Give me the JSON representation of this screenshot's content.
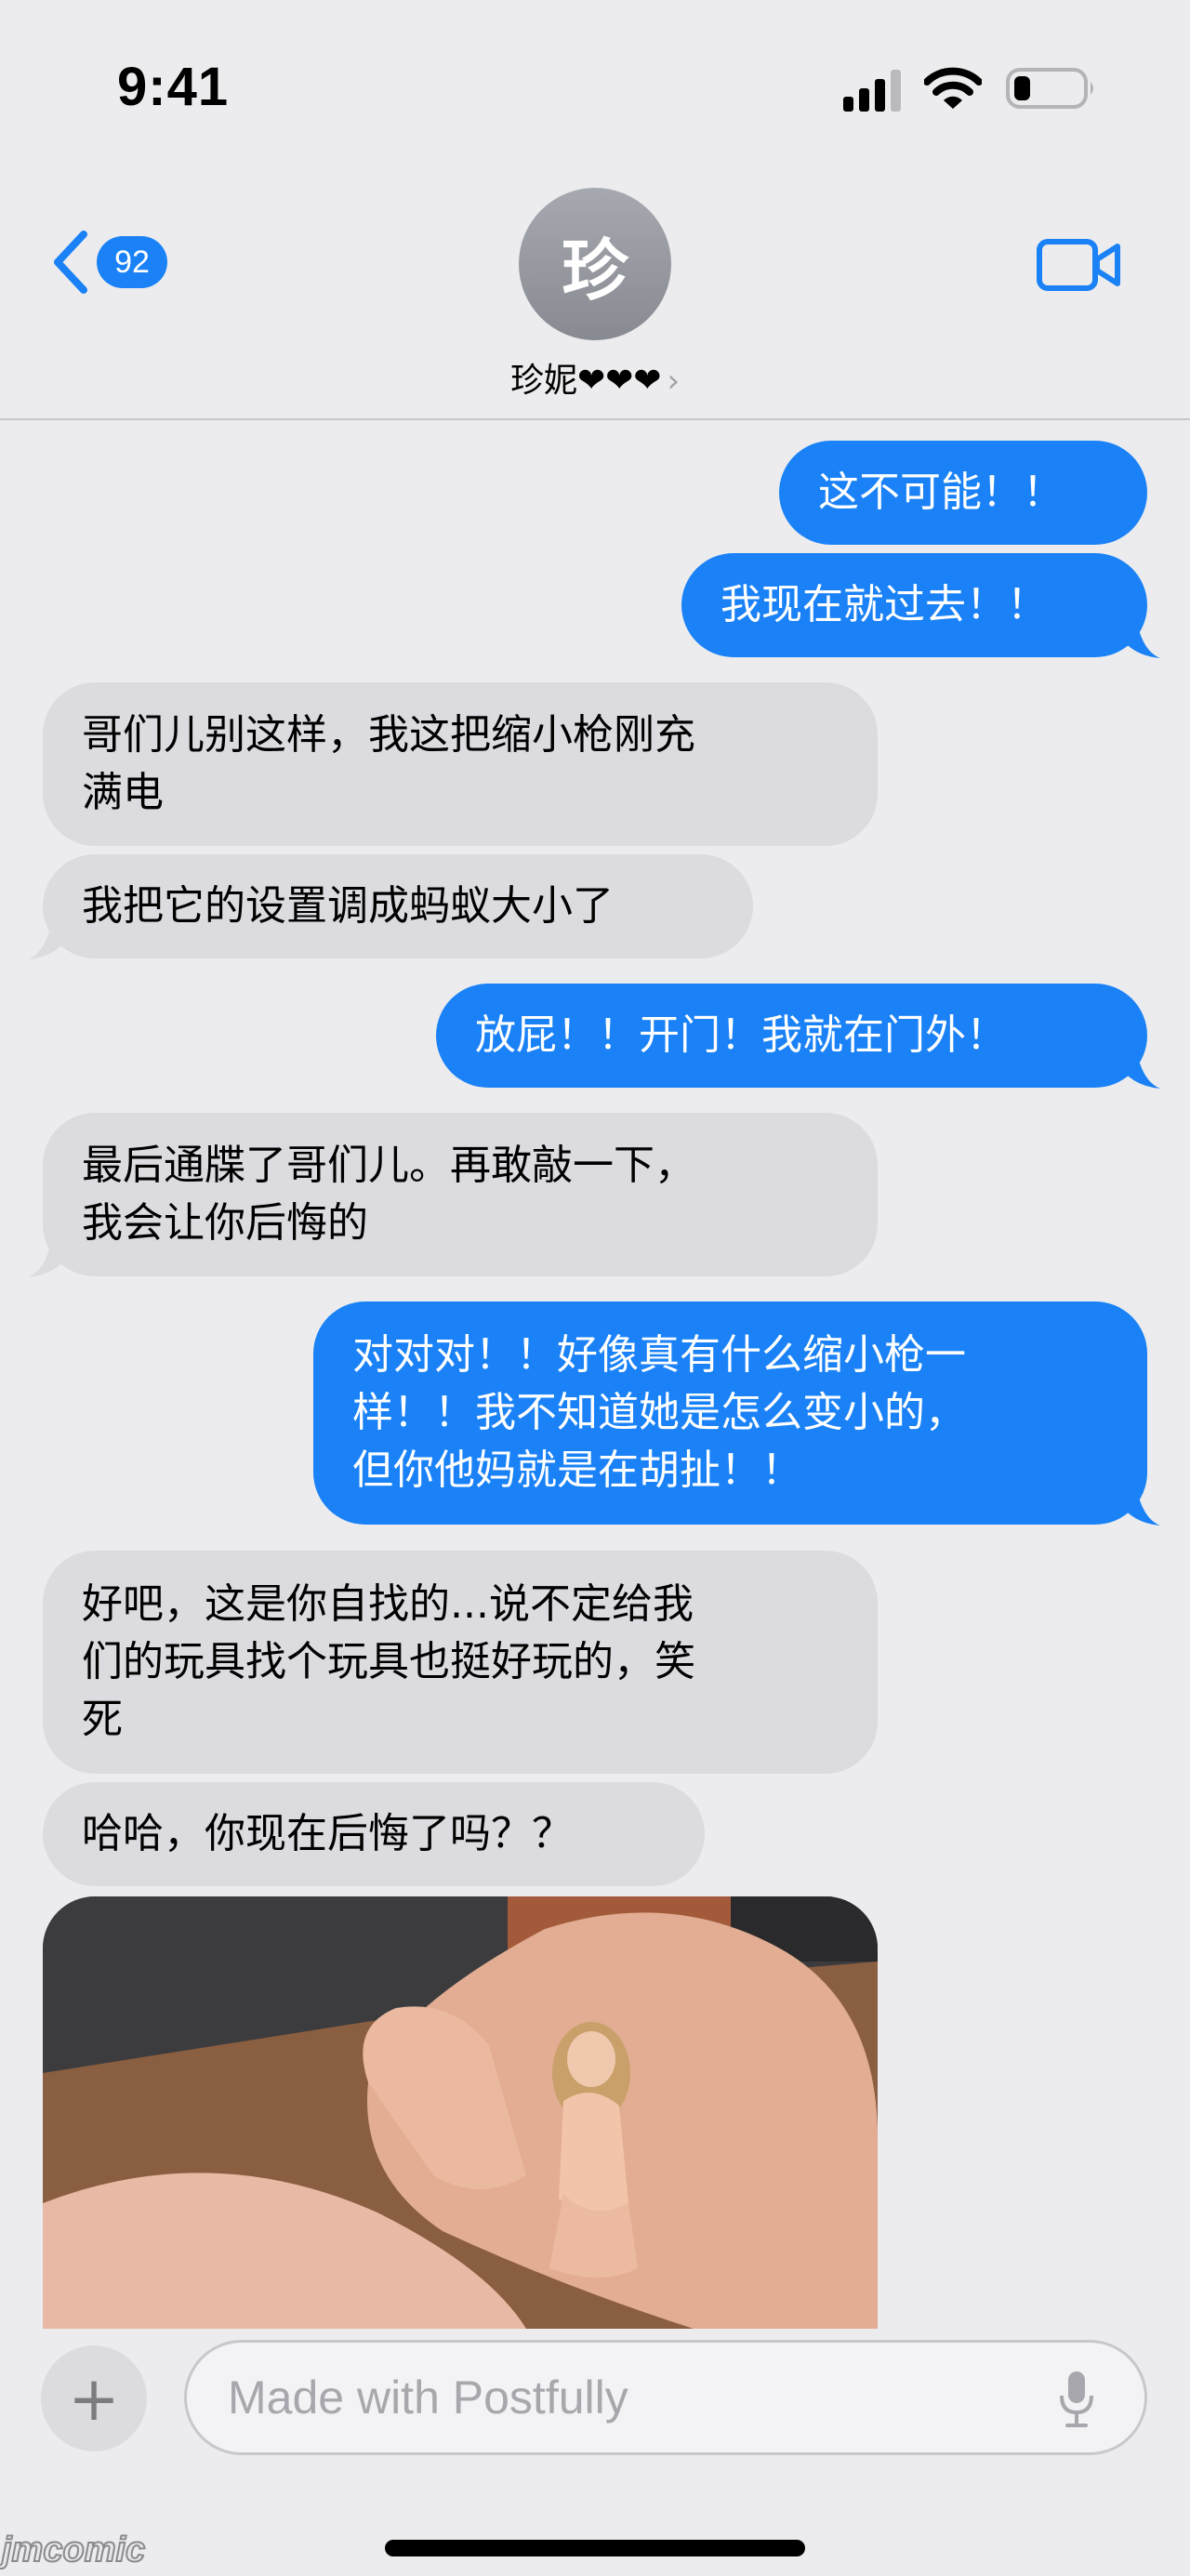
{
  "status_bar": {
    "time": "9:41"
  },
  "header": {
    "unread_count": "92",
    "avatar_initial": "珍",
    "contact_name": "珍妮❤❤❤",
    "contact_chevron": "›"
  },
  "messages": [
    {
      "direction": "sent",
      "text": "这不可能！！"
    },
    {
      "direction": "sent",
      "text": "我现在就过去！！"
    },
    {
      "direction": "received",
      "text": "哥们儿别这样，我这把缩小枪刚充\n满电"
    },
    {
      "direction": "received",
      "text": "我把它的设置调成蚂蚁大小了"
    },
    {
      "direction": "sent",
      "text": "放屁！！开门！我就在门外！"
    },
    {
      "direction": "received",
      "text": "最后通牒了哥们儿。再敢敲一下，\n我会让你后悔的"
    },
    {
      "direction": "sent",
      "text": "对对对！！好像真有什么缩小枪一\n样！！我不知道她是怎么变小的，\n但你他妈就是在胡扯！！"
    },
    {
      "direction": "received",
      "text": "好吧，这是你自找的...说不定给我\n们的玩具找个玩具也挺好玩的，笑\n死"
    },
    {
      "direction": "received",
      "text": "哈哈，你现在后悔了吗？？"
    }
  ],
  "input": {
    "placeholder": "Made with Postfully",
    "plus_label": "+"
  },
  "watermark": "jmcomic",
  "colors": {
    "sent_bubble": "#1a82f6",
    "received_bubble": "#dcdce0",
    "background": "#ececee"
  },
  "icons": [
    "signal-icon",
    "wifi-icon",
    "battery-icon",
    "back-chevron-icon",
    "video-camera-icon",
    "plus-icon",
    "microphone-icon"
  ]
}
